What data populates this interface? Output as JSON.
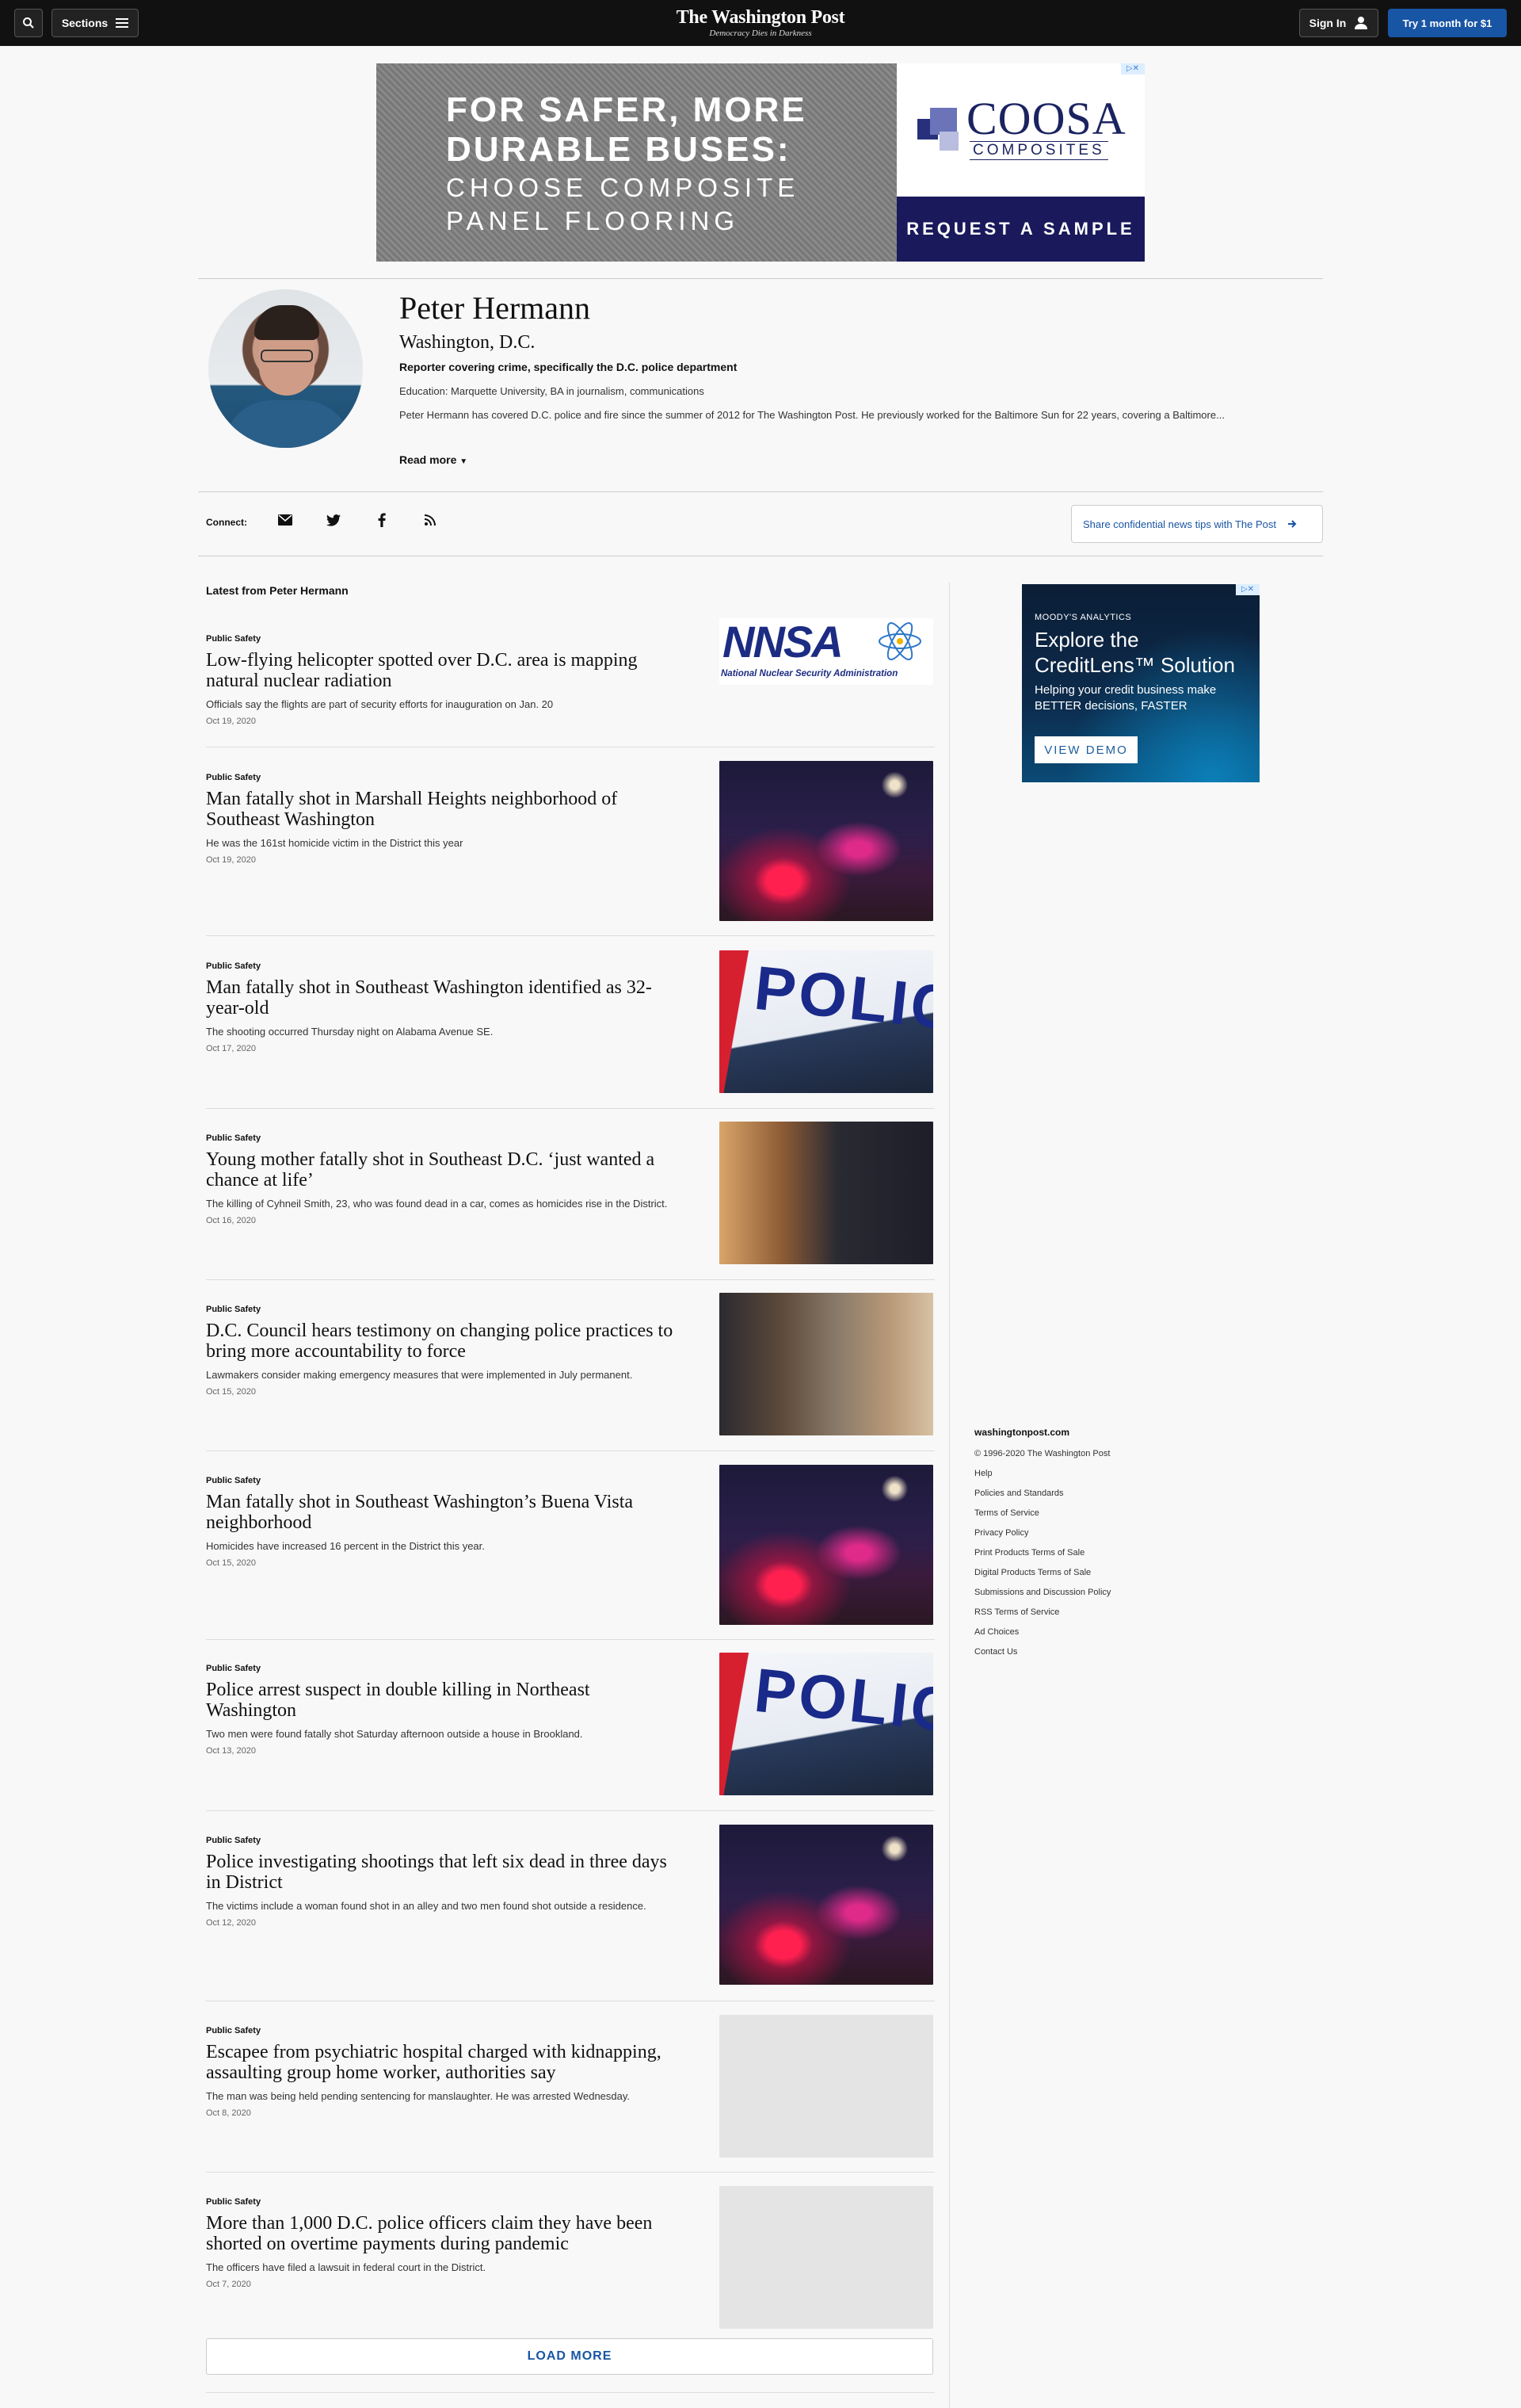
{
  "header": {
    "sections_label": "Sections",
    "logo": "The Washington Post",
    "tagline": "Democracy Dies in Darkness",
    "signin_label": "Sign In",
    "try_label": "Try 1 month for $1"
  },
  "top_ad": {
    "line1": "FOR SAFER, MORE",
    "line2": "DURABLE BUSES:",
    "line3": "CHOOSE COMPOSITE",
    "line4": "PANEL FLOORING",
    "brand": "COOSA",
    "brand_sub": "COMPOSITES",
    "cta": "REQUEST A SAMPLE"
  },
  "author": {
    "name": "Peter Hermann",
    "location": "Washington, D.C.",
    "beat": "Reporter covering crime, specifically the D.C. police department",
    "education": "Education: Marquette University, BA in journalism, communications",
    "bio": "Peter Hermann has covered D.C. police and fire since the summer of 2012 for The Washington Post. He previously worked for the Baltimore Sun for 22 years, covering a Baltimore...",
    "read_more": "Read more"
  },
  "connect": {
    "label": "Connect:",
    "tips": "Share confidential news tips with The Post"
  },
  "latest_title": "Latest from Peter Hermann",
  "articles": [
    {
      "kicker": "Public Safety",
      "headline": "Low-flying helicopter spotted over D.C. area is mapping natural nuclear radiation",
      "blurb": "Officials say the flights are part of security efforts for inauguration on Jan. 20",
      "date": "Oct 19, 2020",
      "image_caption": "National Nuclear Security Administration",
      "image_text": "NNSA"
    },
    {
      "kicker": "Public Safety",
      "headline": "Man fatally shot in Marshall Heights neighborhood of Southeast Washington",
      "blurb": "He was the 161st homicide victim in the District this year",
      "date": "Oct 19, 2020"
    },
    {
      "kicker": "Public Safety",
      "headline": "Man fatally shot in Southeast Washington identified as 32-year-old",
      "blurb": "The shooting occurred Thursday night on Alabama Avenue SE.",
      "date": "Oct 17, 2020",
      "image_text": "POLICE"
    },
    {
      "kicker": "Public Safety",
      "headline": "Young mother fatally shot in Southeast D.C. ‘just wanted a chance at life’",
      "blurb": "The killing of Cyhneil Smith, 23, who was found dead in a car, comes as homicides rise in the District.",
      "date": "Oct 16, 2020"
    },
    {
      "kicker": "Public Safety",
      "headline": "D.C. Council hears testimony on changing police practices to bring more accountability to force",
      "blurb": "Lawmakers consider making emergency measures that were implemented in July permanent.",
      "date": "Oct 15, 2020"
    },
    {
      "kicker": "Public Safety",
      "headline": "Man fatally shot in Southeast Washington’s Buena Vista neighborhood",
      "blurb": "Homicides have increased 16 percent in the District this year.",
      "date": "Oct 15, 2020"
    },
    {
      "kicker": "Public Safety",
      "headline": "Police arrest suspect in double killing in Northeast Washington",
      "blurb": "Two men were found fatally shot Saturday afternoon outside a house in Brookland.",
      "date": "Oct 13, 2020",
      "image_text": "POLICE"
    },
    {
      "kicker": "Public Safety",
      "headline": "Police investigating shootings that left six dead in three days in District",
      "blurb": "The victims include a woman found shot in an alley and two men found shot outside a residence.",
      "date": "Oct 12, 2020"
    },
    {
      "kicker": "Public Safety",
      "headline": "Escapee from psychiatric hospital charged with kidnapping, assaulting group home worker, authorities say",
      "blurb": "The man was being held pending sentencing for manslaughter. He was arrested Wednesday.",
      "date": "Oct 8, 2020"
    },
    {
      "kicker": "Public Safety",
      "headline": "More than 1,000 D.C. police officers claim they have been shorted on overtime payments during pandemic",
      "blurb": "The officers have filed a lawsuit in federal court in the District.",
      "date": "Oct 7, 2020"
    }
  ],
  "load_more": "LOAD MORE",
  "side_ad": {
    "brand": "MOODY'S ANALYTICS",
    "title_pre": "Explore the",
    "title_main": "CreditLens™ Solution",
    "body": "Helping your credit business make BETTER decisions, FASTER",
    "cta": "VIEW DEMO"
  },
  "footer": {
    "site": "washingtonpost.com",
    "links": [
      "© 1996-2020 The Washington Post",
      "Help",
      "Policies and Standards",
      "Terms of Service",
      "Privacy Policy",
      "Print Products Terms of Sale",
      "Digital Products Terms of Sale",
      "Submissions and Discussion Policy",
      "RSS Terms of Service",
      "Ad Choices",
      "Contact Us"
    ]
  },
  "colors": {
    "accent_blue": "#1955a5",
    "topbar": "#111111",
    "background": "#f8f8f8"
  }
}
